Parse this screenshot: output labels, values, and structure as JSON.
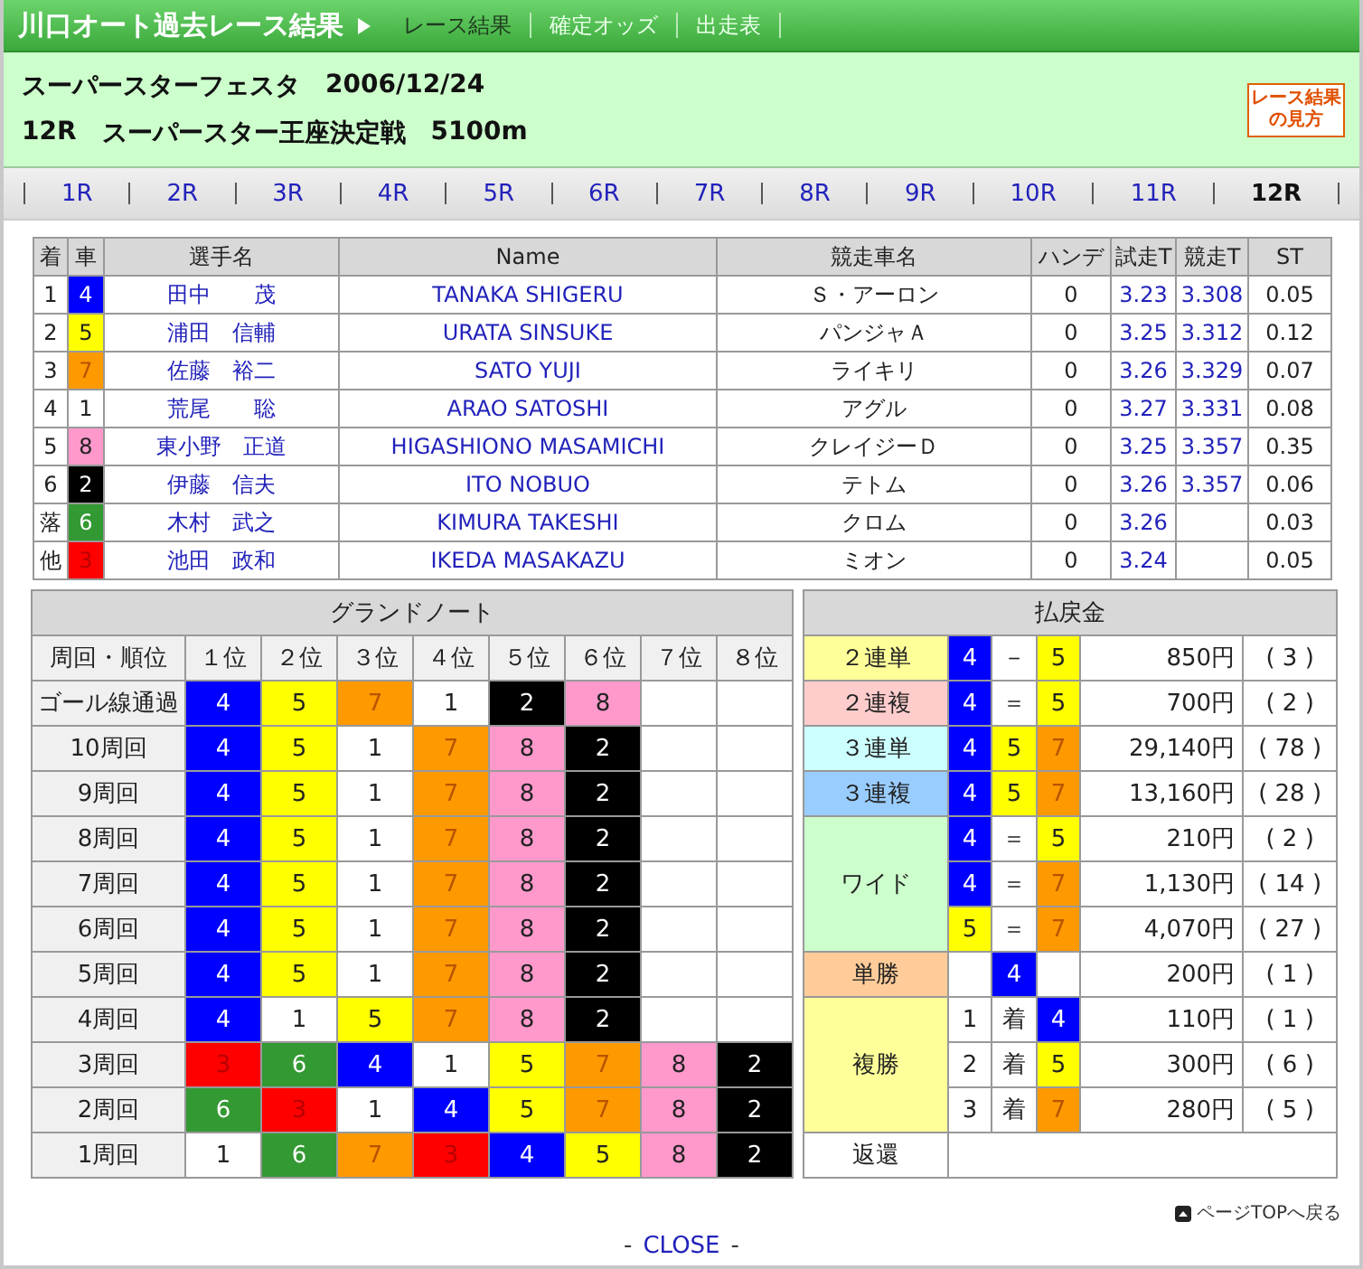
{
  "header": {
    "title": "川口オート過去レース結果",
    "tabs": [
      {
        "label": "レース結果",
        "selected": true
      },
      {
        "label": "確定オッズ",
        "selected": false
      },
      {
        "label": "出走表",
        "selected": false
      }
    ]
  },
  "info": {
    "event": "スーパースターフェスタ",
    "date": "2006/12/24",
    "race": "12R",
    "race_title": "スーパースター王座決定戦",
    "distance": "5100m",
    "guide_badge": "レース結果の見方"
  },
  "race_nav": [
    {
      "label": "1R",
      "selected": false
    },
    {
      "label": "2R",
      "selected": false
    },
    {
      "label": "3R",
      "selected": false
    },
    {
      "label": "4R",
      "selected": false
    },
    {
      "label": "5R",
      "selected": false
    },
    {
      "label": "6R",
      "selected": false
    },
    {
      "label": "7R",
      "selected": false
    },
    {
      "label": "8R",
      "selected": false
    },
    {
      "label": "9R",
      "selected": false
    },
    {
      "label": "10R",
      "selected": false
    },
    {
      "label": "11R",
      "selected": false
    },
    {
      "label": "12R",
      "selected": true
    }
  ],
  "results": {
    "columns": [
      "着",
      "車",
      "選手名",
      "Name",
      "競走車名",
      "ハンデ",
      "試走T",
      "競走T",
      "ST"
    ],
    "rows": [
      {
        "place": "1",
        "car": {
          "number": "4",
          "color": "#0000ff"
        },
        "rider": "田中　　茂",
        "rider_en": "TANAKA SHIGERU",
        "bike": "Ｓ・アーロン",
        "handicap": "0",
        "trial": "3.23",
        "race_time": "3.308",
        "st": "0.05"
      },
      {
        "place": "2",
        "car": {
          "number": "5",
          "color": "#ffff00"
        },
        "rider": "浦田　信輔",
        "rider_en": "URATA SINSUKE",
        "bike": "パンジャＡ",
        "handicap": "0",
        "trial": "3.25",
        "race_time": "3.312",
        "st": "0.12"
      },
      {
        "place": "3",
        "car": {
          "number": "7",
          "color": "#ff9900"
        },
        "rider": "佐藤　裕二",
        "rider_en": "SATO YUJI",
        "bike": "ライキリ",
        "handicap": "0",
        "trial": "3.26",
        "race_time": "3.329",
        "st": "0.07"
      },
      {
        "place": "4",
        "car": {
          "number": "1",
          "color": "#ffffff"
        },
        "rider": "荒尾　　聡",
        "rider_en": "ARAO SATOSHI",
        "bike": "アグル",
        "handicap": "0",
        "trial": "3.27",
        "race_time": "3.331",
        "st": "0.08"
      },
      {
        "place": "5",
        "car": {
          "number": "8",
          "color": "#ff99cc"
        },
        "rider": "東小野　正道",
        "rider_en": "HIGASHIONO MASAMICHI",
        "bike": "クレイジーＤ",
        "handicap": "0",
        "trial": "3.25",
        "race_time": "3.357",
        "st": "0.35"
      },
      {
        "place": "6",
        "car": {
          "number": "2",
          "color": "#000000"
        },
        "rider": "伊藤　信夫",
        "rider_en": "ITO NOBUO",
        "bike": "テトム",
        "handicap": "0",
        "trial": "3.26",
        "race_time": "3.357",
        "st": "0.06"
      },
      {
        "place": "落",
        "car": {
          "number": "6",
          "color": "#339933"
        },
        "rider": "木村　武之",
        "rider_en": "KIMURA TAKESHI",
        "bike": "クロム",
        "handicap": "0",
        "trial": "3.26",
        "st": "0.03"
      },
      {
        "place": "他",
        "car": {
          "number": "3",
          "color": "#ff0000"
        },
        "rider": "池田　政和",
        "rider_en": "IKEDA MASAKAZU",
        "bike": "ミオン",
        "handicap": "0",
        "trial": "3.24",
        "st": "0.05"
      }
    ]
  },
  "grand_note": {
    "title": "グランドノート",
    "columns": [
      "周回・順位",
      "１位",
      "２位",
      "３位",
      "４位",
      "５位",
      "６位",
      "７位",
      "８位"
    ],
    "rows": [
      {
        "label": "ゴール線通過",
        "cars": [
          {
            "car": "4",
            "color": "#0000ff"
          },
          {
            "car": "5",
            "color": "#ffff00"
          },
          {
            "car": "7",
            "color": "#ff9900"
          },
          {
            "car": "1",
            "color": "#ffffff"
          },
          {
            "car": "2",
            "color": "#000000"
          },
          {
            "car": "8",
            "color": "#ff99cc"
          }
        ]
      },
      {
        "label": "10周回",
        "cars": [
          {
            "car": "4",
            "color": "#0000ff"
          },
          {
            "car": "5",
            "color": "#ffff00"
          },
          {
            "car": "1",
            "color": "#ffffff"
          },
          {
            "car": "7",
            "color": "#ff9900"
          },
          {
            "car": "8",
            "color": "#ff99cc"
          },
          {
            "car": "2",
            "color": "#000000"
          }
        ]
      },
      {
        "label": "9周回",
        "cars": [
          {
            "car": "4",
            "color": "#0000ff"
          },
          {
            "car": "5",
            "color": "#ffff00"
          },
          {
            "car": "1",
            "color": "#ffffff"
          },
          {
            "car": "7",
            "color": "#ff9900"
          },
          {
            "car": "8",
            "color": "#ff99cc"
          },
          {
            "car": "2",
            "color": "#000000"
          }
        ]
      },
      {
        "label": "8周回",
        "cars": [
          {
            "car": "4",
            "color": "#0000ff"
          },
          {
            "car": "5",
            "color": "#ffff00"
          },
          {
            "car": "1",
            "color": "#ffffff"
          },
          {
            "car": "7",
            "color": "#ff9900"
          },
          {
            "car": "8",
            "color": "#ff99cc"
          },
          {
            "car": "2",
            "color": "#000000"
          }
        ]
      },
      {
        "label": "7周回",
        "cars": [
          {
            "car": "4",
            "color": "#0000ff"
          },
          {
            "car": "5",
            "color": "#ffff00"
          },
          {
            "car": "1",
            "color": "#ffffff"
          },
          {
            "car": "7",
            "color": "#ff9900"
          },
          {
            "car": "8",
            "color": "#ff99cc"
          },
          {
            "car": "2",
            "color": "#000000"
          }
        ]
      },
      {
        "label": "6周回",
        "cars": [
          {
            "car": "4",
            "color": "#0000ff"
          },
          {
            "car": "5",
            "color": "#ffff00"
          },
          {
            "car": "1",
            "color": "#ffffff"
          },
          {
            "car": "7",
            "color": "#ff9900"
          },
          {
            "car": "8",
            "color": "#ff99cc"
          },
          {
            "car": "2",
            "color": "#000000"
          }
        ]
      },
      {
        "label": "5周回",
        "cars": [
          {
            "car": "4",
            "color": "#0000ff"
          },
          {
            "car": "5",
            "color": "#ffff00"
          },
          {
            "car": "1",
            "color": "#ffffff"
          },
          {
            "car": "7",
            "color": "#ff9900"
          },
          {
            "car": "8",
            "color": "#ff99cc"
          },
          {
            "car": "2",
            "color": "#000000"
          }
        ]
      },
      {
        "label": "4周回",
        "cars": [
          {
            "car": "4",
            "color": "#0000ff"
          },
          {
            "car": "1",
            "color": "#ffffff"
          },
          {
            "car": "5",
            "color": "#ffff00"
          },
          {
            "car": "7",
            "color": "#ff9900"
          },
          {
            "car": "8",
            "color": "#ff99cc"
          },
          {
            "car": "2",
            "color": "#000000"
          }
        ]
      },
      {
        "label": "3周回",
        "cars": [
          {
            "car": "3",
            "color": "#ff0000"
          },
          {
            "car": "6",
            "color": "#339933"
          },
          {
            "car": "4",
            "color": "#0000ff"
          },
          {
            "car": "1",
            "color": "#ffffff"
          },
          {
            "car": "5",
            "color": "#ffff00"
          },
          {
            "car": "7",
            "color": "#ff9900"
          },
          {
            "car": "8",
            "color": "#ff99cc"
          },
          {
            "car": "2",
            "color": "#000000"
          }
        ]
      },
      {
        "label": "2周回",
        "cars": [
          {
            "car": "6",
            "color": "#339933"
          },
          {
            "car": "3",
            "color": "#ff0000"
          },
          {
            "car": "1",
            "color": "#ffffff"
          },
          {
            "car": "4",
            "color": "#0000ff"
          },
          {
            "car": "5",
            "color": "#ffff00"
          },
          {
            "car": "7",
            "color": "#ff9900"
          },
          {
            "car": "8",
            "color": "#ff99cc"
          },
          {
            "car": "2",
            "color": "#000000"
          }
        ]
      },
      {
        "label": "1周回",
        "cars": [
          {
            "car": "1",
            "color": "#ffffff"
          },
          {
            "car": "6",
            "color": "#339933"
          },
          {
            "car": "7",
            "color": "#ff9900"
          },
          {
            "car": "3",
            "color": "#ff0000"
          },
          {
            "car": "4",
            "color": "#0000ff"
          },
          {
            "car": "5",
            "color": "#ffff00"
          },
          {
            "car": "8",
            "color": "#ff99cc"
          },
          {
            "car": "2",
            "color": "#000000"
          }
        ]
      }
    ]
  },
  "payouts": {
    "title": "払戻金",
    "bets": [
      {
        "label": "２連単",
        "color": "#ffff99",
        "rows": [
          {
            "cells": [
              {
                "text": "4",
                "color": "#0000ff"
              },
              {
                "text": "－"
              },
              {
                "text": "5",
                "color": "#ffff00"
              }
            ],
            "amount": "850円",
            "popularity": "( 3 )"
          }
        ]
      },
      {
        "label": "２連複",
        "color": "#ffcccc",
        "rows": [
          {
            "cells": [
              {
                "text": "4",
                "color": "#0000ff"
              },
              {
                "text": "＝"
              },
              {
                "text": "5",
                "color": "#ffff00"
              }
            ],
            "amount": "700円",
            "popularity": "( 2 )"
          }
        ]
      },
      {
        "label": "３連単",
        "color": "#ccffff",
        "rows": [
          {
            "cells": [
              {
                "text": "4",
                "color": "#0000ff"
              },
              {
                "text": "5",
                "color": "#ffff00"
              },
              {
                "text": "7",
                "color": "#ff9900"
              }
            ],
            "amount": "29,140円",
            "popularity": "( 78 )"
          }
        ]
      },
      {
        "label": "３連複",
        "color": "#99ccff",
        "rows": [
          {
            "cells": [
              {
                "text": "4",
                "color": "#0000ff"
              },
              {
                "text": "5",
                "color": "#ffff00"
              },
              {
                "text": "7",
                "color": "#ff9900"
              }
            ],
            "amount": "13,160円",
            "popularity": "( 28 )"
          }
        ]
      },
      {
        "label": "ワイド",
        "color": "#ccffcc",
        "rows": [
          {
            "cells": [
              {
                "text": "4",
                "color": "#0000ff"
              },
              {
                "text": "＝"
              },
              {
                "text": "5",
                "color": "#ffff00"
              }
            ],
            "amount": "210円",
            "popularity": "( 2 )"
          },
          {
            "cells": [
              {
                "text": "4",
                "color": "#0000ff"
              },
              {
                "text": "＝"
              },
              {
                "text": "7",
                "color": "#ff9900"
              }
            ],
            "amount": "1,130円",
            "popularity": "( 14 )"
          },
          {
            "cells": [
              {
                "text": "5",
                "color": "#ffff00"
              },
              {
                "text": "＝"
              },
              {
                "text": "7",
                "color": "#ff9900"
              }
            ],
            "amount": "4,070円",
            "popularity": "( 27 )"
          }
        ]
      },
      {
        "label": "単勝",
        "color": "#ffcc99",
        "rows": [
          {
            "cells": [
              null,
              {
                "text": "4",
                "color": "#0000ff"
              },
              null
            ],
            "amount": "200円",
            "popularity": "( 1 )"
          }
        ]
      },
      {
        "label": "複勝",
        "color": "#ffff99",
        "rows": [
          {
            "cells": [
              {
                "text": "1"
              },
              {
                "text": "着"
              },
              {
                "text": "4",
                "color": "#0000ff"
              }
            ],
            "amount": "110円",
            "popularity": "( 1 )"
          },
          {
            "cells": [
              {
                "text": "2"
              },
              {
                "text": "着"
              },
              {
                "text": "5",
                "color": "#ffff00"
              }
            ],
            "amount": "300円",
            "popularity": "( 6 )"
          },
          {
            "cells": [
              {
                "text": "3"
              },
              {
                "text": "着"
              },
              {
                "text": "7",
                "color": "#ff9900"
              }
            ],
            "amount": "280円",
            "popularity": "( 5 )"
          }
        ]
      },
      {
        "label": "返還",
        "color": "#ffffff"
      }
    ]
  },
  "footer": {
    "page_top": "ページTOPへ戻る",
    "close_before": "-",
    "close": "CLOSE",
    "close_after": "-"
  }
}
